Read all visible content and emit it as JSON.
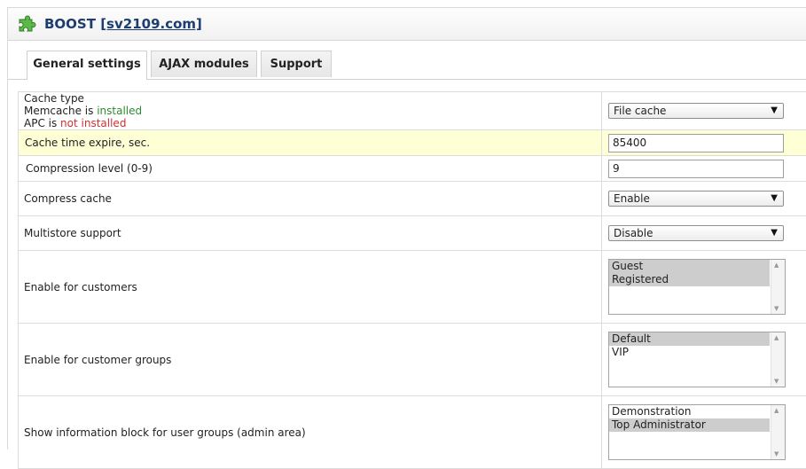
{
  "header": {
    "icon": "puzzle-piece-icon",
    "title_prefix": "BOOST ",
    "title_link": "[sv2109.com]",
    "accent": "#4aa838"
  },
  "tabs": [
    {
      "label": "General settings",
      "active": true
    },
    {
      "label": "AJAX modules",
      "active": false
    },
    {
      "label": "Support",
      "active": false
    }
  ],
  "rows": {
    "cache_type": {
      "label": "Cache type",
      "memcache_prefix": "Memcache is ",
      "memcache_status": "installed",
      "apc_prefix": "APC is ",
      "apc_status": "not installed",
      "value": "File cache"
    },
    "cache_time": {
      "label": "Cache time expire, sec.",
      "value": "85400"
    },
    "compression": {
      "label": "Compression level (0-9)",
      "value": "9"
    },
    "compress_cache": {
      "label": "Compress cache",
      "value": "Enable"
    },
    "multistore": {
      "label": "Multistore support",
      "value": "Disable"
    },
    "customers": {
      "label": "Enable for customers",
      "options": [
        {
          "label": "Guest",
          "selected": true
        },
        {
          "label": "Registered",
          "selected": true
        }
      ]
    },
    "customer_groups": {
      "label": "Enable for customer groups",
      "options": [
        {
          "label": "Default",
          "selected": true
        },
        {
          "label": "VIP",
          "selected": false
        }
      ]
    },
    "user_groups": {
      "label": "Show information block for user groups (admin area)",
      "options": [
        {
          "label": "Demonstration",
          "selected": false
        },
        {
          "label": "Top Administrator",
          "selected": true
        }
      ]
    }
  }
}
